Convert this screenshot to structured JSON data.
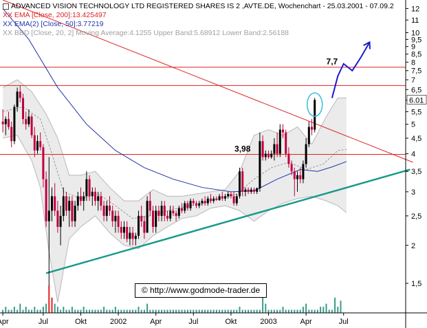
{
  "header": {
    "title": "ADVANCED VISION TECHNOLOGY LTD REGISTERED SHARES IS 2 ,AVTE.DE, Wochenchart - 25.03.2001 - 07.09.2",
    "legend_ema200": "XX EMA [Close, 200]:13.425497",
    "legend_ema50": "XX EMA(2) [Close, 50]:3.77219",
    "legend_bbd": "XX BBD [Close, 20, 2] Moving Average:4.1255  Upper Band:5.68912 Lower Band:2.56188"
  },
  "watermark": "© http://www.godmode-trader.de",
  "colors": {
    "candle_up": "#000000",
    "candle_down": "#c0003c",
    "ema_long": "#dd2222",
    "ema_short": "#2233aa",
    "bands_fill": "#ebebeb",
    "bands_line": "#b8b8b8",
    "trend_line": "#1a9a8a",
    "horizontal_lines": "#dd2222",
    "projection": "#1a1acc",
    "circle": "#33bbdd",
    "volume": "#3a9a8a",
    "volume_highlight": "#dd2222"
  },
  "chart_data": {
    "type": "candlestick",
    "y_scale": "log",
    "ylim": [
      1.2,
      12.8
    ],
    "y_ticks": [
      "1,5",
      "2",
      "2,5",
      "3",
      "3,5",
      "4",
      "4,5",
      "5",
      "5,5",
      "6",
      "6,5",
      "7",
      "7,5",
      "8",
      "8,5",
      "9",
      "9,5",
      "10",
      "11",
      "12"
    ],
    "y_tick_values": [
      1.5,
      2,
      2.5,
      3,
      3.5,
      4,
      4.5,
      5,
      5.5,
      6,
      6.5,
      7,
      7.5,
      8,
      8.5,
      9,
      9.5,
      10,
      11,
      12
    ],
    "last_price_label": "6.01",
    "last_price": 6.01,
    "x_ticks": [
      "Apr",
      "Jul",
      "Okt",
      "2002",
      "Apr",
      "Jul",
      "Okt",
      "2003",
      "Apr",
      "Jul"
    ],
    "x_tick_weeks": [
      1,
      15,
      28,
      41,
      54,
      67,
      80,
      93,
      106,
      119
    ],
    "weeks_total": 140,
    "annotations": [
      {
        "text": "7,7",
        "price": 7.7,
        "week": 115
      },
      {
        "text": "3,98",
        "price": 3.98,
        "week": 84
      }
    ],
    "horizontal_levels": [
      7.7,
      6.7,
      3.98
    ],
    "candles": [
      {
        "o": 5.1,
        "h": 5.6,
        "l": 4.7,
        "c": 5.0
      },
      {
        "o": 5.0,
        "h": 5.3,
        "l": 4.6,
        "c": 5.2
      },
      {
        "o": 5.2,
        "h": 5.5,
        "l": 4.8,
        "c": 4.9
      },
      {
        "o": 4.9,
        "h": 5.1,
        "l": 4.2,
        "c": 4.4
      },
      {
        "o": 4.4,
        "h": 5.8,
        "l": 4.3,
        "c": 5.7
      },
      {
        "o": 5.7,
        "h": 6.6,
        "l": 5.5,
        "c": 6.4
      },
      {
        "o": 6.4,
        "h": 6.7,
        "l": 5.9,
        "c": 6.1
      },
      {
        "o": 6.1,
        "h": 6.3,
        "l": 5.0,
        "c": 5.2
      },
      {
        "o": 5.2,
        "h": 5.5,
        "l": 4.8,
        "c": 5.0
      },
      {
        "o": 5.0,
        "h": 5.6,
        "l": 4.9,
        "c": 5.3
      },
      {
        "o": 5.3,
        "h": 5.4,
        "l": 4.5,
        "c": 4.6
      },
      {
        "o": 4.6,
        "h": 4.9,
        "l": 3.9,
        "c": 4.1
      },
      {
        "o": 4.1,
        "h": 4.6,
        "l": 4.0,
        "c": 4.4
      },
      {
        "o": 4.4,
        "h": 4.7,
        "l": 4.1,
        "c": 4.2
      },
      {
        "o": 4.2,
        "h": 4.3,
        "l": 3.1,
        "c": 3.3
      },
      {
        "o": 3.3,
        "h": 3.5,
        "l": 2.3,
        "c": 2.4
      },
      {
        "o": 2.4,
        "h": 3.9,
        "l": 1.2,
        "c": 2.6
      },
      {
        "o": 2.6,
        "h": 3.1,
        "l": 2.4,
        "c": 2.9
      },
      {
        "o": 2.9,
        "h": 3.2,
        "l": 2.5,
        "c": 2.6
      },
      {
        "o": 2.6,
        "h": 2.8,
        "l": 2.2,
        "c": 2.3
      },
      {
        "o": 2.3,
        "h": 2.7,
        "l": 2.0,
        "c": 2.5
      },
      {
        "o": 2.5,
        "h": 3.1,
        "l": 2.4,
        "c": 2.9
      },
      {
        "o": 2.9,
        "h": 3.0,
        "l": 2.5,
        "c": 2.6
      },
      {
        "o": 2.6,
        "h": 2.9,
        "l": 2.3,
        "c": 2.8
      },
      {
        "o": 2.8,
        "h": 2.9,
        "l": 2.3,
        "c": 2.4
      },
      {
        "o": 2.4,
        "h": 2.8,
        "l": 2.3,
        "c": 2.7
      },
      {
        "o": 2.7,
        "h": 3.0,
        "l": 2.6,
        "c": 2.9
      },
      {
        "o": 2.9,
        "h": 3.1,
        "l": 2.7,
        "c": 2.8
      },
      {
        "o": 2.8,
        "h": 3.0,
        "l": 2.6,
        "c": 2.9
      },
      {
        "o": 2.9,
        "h": 3.5,
        "l": 2.8,
        "c": 3.3
      },
      {
        "o": 3.3,
        "h": 3.4,
        "l": 2.8,
        "c": 2.9
      },
      {
        "o": 2.9,
        "h": 3.1,
        "l": 2.7,
        "c": 3.0
      },
      {
        "o": 3.0,
        "h": 3.1,
        "l": 2.7,
        "c": 2.8
      },
      {
        "o": 2.8,
        "h": 3.0,
        "l": 2.6,
        "c": 2.9
      },
      {
        "o": 2.9,
        "h": 3.0,
        "l": 2.6,
        "c": 2.7
      },
      {
        "o": 2.7,
        "h": 2.8,
        "l": 2.4,
        "c": 2.5
      },
      {
        "o": 2.5,
        "h": 2.8,
        "l": 2.4,
        "c": 2.7
      },
      {
        "o": 2.7,
        "h": 2.9,
        "l": 2.5,
        "c": 2.6
      },
      {
        "o": 2.6,
        "h": 2.7,
        "l": 2.3,
        "c": 2.4
      },
      {
        "o": 2.4,
        "h": 2.6,
        "l": 2.2,
        "c": 2.5
      },
      {
        "o": 2.5,
        "h": 2.6,
        "l": 2.2,
        "c": 2.3
      },
      {
        "o": 2.3,
        "h": 2.4,
        "l": 2.1,
        "c": 2.2
      },
      {
        "o": 2.2,
        "h": 2.4,
        "l": 2.1,
        "c": 2.3
      },
      {
        "o": 2.3,
        "h": 2.4,
        "l": 2.05,
        "c": 2.1
      },
      {
        "o": 2.1,
        "h": 2.3,
        "l": 2.0,
        "c": 2.2
      },
      {
        "o": 2.2,
        "h": 2.3,
        "l": 2.0,
        "c": 2.1
      },
      {
        "o": 2.1,
        "h": 2.2,
        "l": 2.0,
        "c": 2.15
      },
      {
        "o": 2.15,
        "h": 2.6,
        "l": 2.1,
        "c": 2.5
      },
      {
        "o": 2.5,
        "h": 2.7,
        "l": 2.3,
        "c": 2.4
      },
      {
        "o": 2.4,
        "h": 2.5,
        "l": 2.1,
        "c": 2.2
      },
      {
        "o": 2.2,
        "h": 2.9,
        "l": 2.2,
        "c": 2.8
      },
      {
        "o": 2.8,
        "h": 3.0,
        "l": 2.5,
        "c": 2.6
      },
      {
        "o": 2.6,
        "h": 2.7,
        "l": 2.2,
        "c": 2.3
      },
      {
        "o": 2.3,
        "h": 2.7,
        "l": 2.2,
        "c": 2.6
      },
      {
        "o": 2.6,
        "h": 2.7,
        "l": 2.4,
        "c": 2.5
      },
      {
        "o": 2.5,
        "h": 2.8,
        "l": 2.4,
        "c": 2.7
      },
      {
        "o": 2.7,
        "h": 2.8,
        "l": 2.4,
        "c": 2.5
      },
      {
        "o": 2.5,
        "h": 2.6,
        "l": 2.4,
        "c": 2.45
      },
      {
        "o": 2.45,
        "h": 2.7,
        "l": 2.4,
        "c": 2.6
      },
      {
        "o": 2.6,
        "h": 2.7,
        "l": 2.5,
        "c": 2.55
      },
      {
        "o": 2.55,
        "h": 2.6,
        "l": 2.4,
        "c": 2.5
      },
      {
        "o": 2.5,
        "h": 2.7,
        "l": 2.45,
        "c": 2.65
      },
      {
        "o": 2.65,
        "h": 2.75,
        "l": 2.55,
        "c": 2.6
      },
      {
        "o": 2.6,
        "h": 2.8,
        "l": 2.55,
        "c": 2.75
      },
      {
        "o": 2.75,
        "h": 2.8,
        "l": 2.6,
        "c": 2.65
      },
      {
        "o": 2.65,
        "h": 2.85,
        "l": 2.6,
        "c": 2.8
      },
      {
        "o": 2.8,
        "h": 2.85,
        "l": 2.7,
        "c": 2.75
      },
      {
        "o": 2.75,
        "h": 2.8,
        "l": 2.65,
        "c": 2.7
      },
      {
        "o": 2.7,
        "h": 2.8,
        "l": 2.65,
        "c": 2.75
      },
      {
        "o": 2.75,
        "h": 2.85,
        "l": 2.7,
        "c": 2.8
      },
      {
        "o": 2.8,
        "h": 2.9,
        "l": 2.7,
        "c": 2.75
      },
      {
        "o": 2.75,
        "h": 2.9,
        "l": 2.7,
        "c": 2.85
      },
      {
        "o": 2.85,
        "h": 2.95,
        "l": 2.75,
        "c": 2.8
      },
      {
        "o": 2.8,
        "h": 2.9,
        "l": 2.75,
        "c": 2.85
      },
      {
        "o": 2.85,
        "h": 2.9,
        "l": 2.8,
        "c": 2.82
      },
      {
        "o": 2.82,
        "h": 2.95,
        "l": 2.8,
        "c": 2.9
      },
      {
        "o": 2.9,
        "h": 3.0,
        "l": 2.8,
        "c": 2.85
      },
      {
        "o": 2.85,
        "h": 2.95,
        "l": 2.8,
        "c": 2.9
      },
      {
        "o": 2.9,
        "h": 3.0,
        "l": 2.85,
        "c": 2.95
      },
      {
        "o": 2.95,
        "h": 3.0,
        "l": 2.85,
        "c": 2.9
      },
      {
        "o": 2.9,
        "h": 3.0,
        "l": 2.7,
        "c": 2.75
      },
      {
        "o": 2.75,
        "h": 2.95,
        "l": 2.7,
        "c": 2.9
      },
      {
        "o": 2.9,
        "h": 3.6,
        "l": 2.85,
        "c": 3.5
      },
      {
        "o": 3.5,
        "h": 3.6,
        "l": 2.9,
        "c": 3.0
      },
      {
        "o": 3.0,
        "h": 3.1,
        "l": 2.9,
        "c": 3.05
      },
      {
        "o": 3.05,
        "h": 3.1,
        "l": 2.95,
        "c": 3.0
      },
      {
        "o": 3.0,
        "h": 3.1,
        "l": 2.95,
        "c": 3.05
      },
      {
        "o": 3.05,
        "h": 3.1,
        "l": 2.95,
        "c": 3.0
      },
      {
        "o": 3.0,
        "h": 3.1,
        "l": 2.95,
        "c": 3.08
      },
      {
        "o": 3.08,
        "h": 4.7,
        "l": 3.0,
        "c": 4.4
      },
      {
        "o": 4.4,
        "h": 4.6,
        "l": 3.8,
        "c": 3.9
      },
      {
        "o": 3.9,
        "h": 4.1,
        "l": 3.8,
        "c": 4.0
      },
      {
        "o": 4.0,
        "h": 4.1,
        "l": 3.85,
        "c": 3.9
      },
      {
        "o": 3.9,
        "h": 4.1,
        "l": 3.85,
        "c": 4.0
      },
      {
        "o": 4.0,
        "h": 4.5,
        "l": 3.8,
        "c": 4.3
      },
      {
        "o": 4.3,
        "h": 4.7,
        "l": 3.9,
        "c": 4.0
      },
      {
        "o": 4.0,
        "h": 5.0,
        "l": 3.9,
        "c": 4.8
      },
      {
        "o": 4.8,
        "h": 5.0,
        "l": 4.5,
        "c": 4.7
      },
      {
        "o": 4.7,
        "h": 4.8,
        "l": 3.9,
        "c": 4.0
      },
      {
        "o": 4.0,
        "h": 4.2,
        "l": 3.6,
        "c": 3.7
      },
      {
        "o": 3.7,
        "h": 3.8,
        "l": 3.4,
        "c": 3.5
      },
      {
        "o": 3.5,
        "h": 3.6,
        "l": 2.9,
        "c": 3.3
      },
      {
        "o": 3.3,
        "h": 3.5,
        "l": 3.0,
        "c": 3.4
      },
      {
        "o": 3.4,
        "h": 3.6,
        "l": 3.2,
        "c": 3.3
      },
      {
        "o": 3.3,
        "h": 3.8,
        "l": 3.2,
        "c": 3.7
      },
      {
        "o": 3.7,
        "h": 4.5,
        "l": 3.6,
        "c": 4.3
      },
      {
        "o": 4.3,
        "h": 5.1,
        "l": 4.2,
        "c": 4.9
      },
      {
        "o": 4.9,
        "h": 5.2,
        "l": 4.6,
        "c": 4.8
      },
      {
        "o": 4.8,
        "h": 6.1,
        "l": 4.7,
        "c": 6.01
      }
    ],
    "ema_long": [
      [
        1,
        12.0
      ],
      [
        14,
        9.6
      ],
      [
        27,
        7.7
      ],
      [
        40,
        6.2
      ],
      [
        53,
        5.2
      ],
      [
        66,
        4.4
      ],
      [
        79,
        3.9
      ],
      [
        92,
        3.55
      ],
      [
        105,
        3.35
      ]
    ],
    "ema_short": [
      [
        1,
        12.0
      ],
      [
        10,
        9.5
      ],
      [
        20,
        6.6
      ],
      [
        30,
        5.0
      ],
      [
        40,
        4.1
      ],
      [
        50,
        3.6
      ],
      [
        60,
        3.3
      ],
      [
        70,
        3.1
      ],
      [
        80,
        3.0
      ],
      [
        88,
        3.02
      ],
      [
        96,
        3.3
      ],
      [
        104,
        3.55
      ],
      [
        110,
        3.5
      ],
      [
        115,
        3.62
      ],
      [
        120,
        3.77
      ]
    ],
    "bb_upper": [
      [
        1,
        6.6
      ],
      [
        6,
        7.0
      ],
      [
        11,
        6.4
      ],
      [
        16,
        5.4
      ],
      [
        20,
        4.5
      ],
      [
        24,
        3.4
      ],
      [
        28,
        3.4
      ],
      [
        33,
        3.5
      ],
      [
        38,
        3.1
      ],
      [
        43,
        2.8
      ],
      [
        48,
        2.8
      ],
      [
        53,
        3.05
      ],
      [
        58,
        2.9
      ],
      [
        63,
        2.9
      ],
      [
        68,
        2.95
      ],
      [
        73,
        3.0
      ],
      [
        78,
        3.05
      ],
      [
        83,
        3.5
      ],
      [
        88,
        4.6
      ],
      [
        93,
        4.8
      ],
      [
        98,
        4.6
      ],
      [
        103,
        4.9
      ],
      [
        108,
        4.3
      ],
      [
        113,
        5.3
      ],
      [
        117,
        6.1
      ],
      [
        120,
        6.1
      ]
    ],
    "bb_lower": [
      [
        1,
        4.5
      ],
      [
        6,
        4.6
      ],
      [
        11,
        3.8
      ],
      [
        14,
        3.1
      ],
      [
        17,
        1.9
      ],
      [
        20,
        1.3
      ],
      [
        24,
        2.1
      ],
      [
        28,
        2.3
      ],
      [
        33,
        2.5
      ],
      [
        38,
        2.2
      ],
      [
        43,
        2.0
      ],
      [
        48,
        1.95
      ],
      [
        53,
        2.15
      ],
      [
        58,
        2.3
      ],
      [
        63,
        2.45
      ],
      [
        68,
        2.5
      ],
      [
        73,
        2.65
      ],
      [
        78,
        2.7
      ],
      [
        83,
        2.6
      ],
      [
        88,
        2.4
      ],
      [
        93,
        2.6
      ],
      [
        98,
        2.75
      ],
      [
        103,
        2.85
      ],
      [
        108,
        2.9
      ],
      [
        113,
        2.8
      ],
      [
        117,
        2.7
      ],
      [
        120,
        2.56
      ]
    ],
    "bb_middle": [
      [
        1,
        5.5
      ],
      [
        8,
        5.7
      ],
      [
        14,
        5.2
      ],
      [
        18,
        4.0
      ],
      [
        22,
        3.0
      ],
      [
        28,
        2.85
      ],
      [
        34,
        2.95
      ],
      [
        40,
        2.7
      ],
      [
        46,
        2.45
      ],
      [
        52,
        2.5
      ],
      [
        58,
        2.6
      ],
      [
        64,
        2.68
      ],
      [
        70,
        2.75
      ],
      [
        76,
        2.85
      ],
      [
        82,
        2.95
      ],
      [
        88,
        3.3
      ],
      [
        94,
        3.6
      ],
      [
        100,
        3.75
      ],
      [
        106,
        3.55
      ],
      [
        112,
        3.7
      ],
      [
        117,
        4.1
      ],
      [
        120,
        4.13
      ]
    ],
    "trend_line": [
      [
        16,
        1.62
      ],
      [
        142,
        3.55
      ]
    ],
    "ema_long_extension": [
      [
        1,
        12.8
      ],
      [
        143,
        3.75
      ]
    ],
    "projection": [
      [
        115,
        6.1
      ],
      [
        117,
        7.2
      ],
      [
        119,
        7.9
      ],
      [
        122,
        7.5
      ],
      [
        125,
        8.3
      ],
      [
        128,
        9.3
      ]
    ],
    "volume": [
      1,
      2,
      1,
      1,
      2,
      1,
      3,
      1,
      2,
      1,
      1,
      2,
      1,
      1,
      2,
      3,
      9,
      5,
      3,
      2,
      1,
      2,
      1,
      1,
      2,
      1,
      1,
      1,
      2,
      1,
      1,
      1,
      1,
      1,
      1,
      2,
      1,
      1,
      1,
      2,
      1,
      1,
      1,
      1,
      1,
      1,
      1,
      2,
      1,
      1,
      3,
      1,
      1,
      1,
      1,
      1,
      1,
      1,
      1,
      1,
      1,
      1,
      1,
      1,
      1,
      1,
      1,
      1,
      1,
      1,
      1,
      1,
      1,
      1,
      1,
      1,
      1,
      1,
      1,
      1,
      1,
      1,
      2,
      1,
      1,
      1,
      1,
      1,
      1,
      1,
      5,
      3,
      1,
      1,
      1,
      1,
      1,
      2,
      1,
      1,
      1,
      1,
      1,
      1,
      2,
      3,
      1,
      1,
      1,
      1,
      2,
      2,
      3,
      1,
      1,
      5,
      2,
      4
    ],
    "volume_highlight_indices": [
      16,
      17
    ]
  }
}
